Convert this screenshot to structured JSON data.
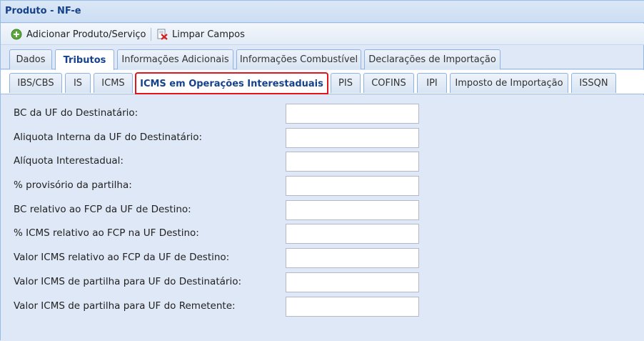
{
  "window": {
    "title": "Produto - NF-e"
  },
  "toolbar": {
    "add_label": "Adicionar Produto/Serviço",
    "add_icon": "plus-circle-icon",
    "clear_label": "Limpar Campos",
    "clear_icon": "eraser-x-icon"
  },
  "tabs_main": [
    {
      "label": "Dados"
    },
    {
      "label": "Tributos"
    },
    {
      "label": "Informações Adicionais"
    },
    {
      "label": "Informações Combustível"
    },
    {
      "label": "Declarações de Importação"
    }
  ],
  "tabs_tributos": [
    {
      "label": "IBS/CBS"
    },
    {
      "label": "IS"
    },
    {
      "label": "ICMS"
    },
    {
      "label": "ICMS em Operações Interestaduais"
    },
    {
      "label": "PIS"
    },
    {
      "label": "COFINS"
    },
    {
      "label": "IPI"
    },
    {
      "label": "Imposto de Importação"
    },
    {
      "label": "ISSQN"
    }
  ],
  "fields": [
    {
      "label": "BC da UF do Destinatário:",
      "value": ""
    },
    {
      "label": "Aliquota Interna da UF do Destinatário:",
      "value": ""
    },
    {
      "label": "Alíquota Interestadual:",
      "value": ""
    },
    {
      "label": "% provisório da partilha:",
      "value": ""
    },
    {
      "label": "BC relativo ao FCP da UF de Destino:",
      "value": ""
    },
    {
      "label": "% ICMS relativo ao FCP na UF Destino:",
      "value": ""
    },
    {
      "label": "Valor ICMS relativo ao FCP da UF de Destino:",
      "value": ""
    },
    {
      "label": "Valor ICMS de partilha para UF do Destinatário:",
      "value": ""
    },
    {
      "label": "Valor ICMS de partilha para UF do Remetente:",
      "value": ""
    }
  ],
  "colors": {
    "highlight": "#e0151e",
    "accent": "#15428b"
  }
}
